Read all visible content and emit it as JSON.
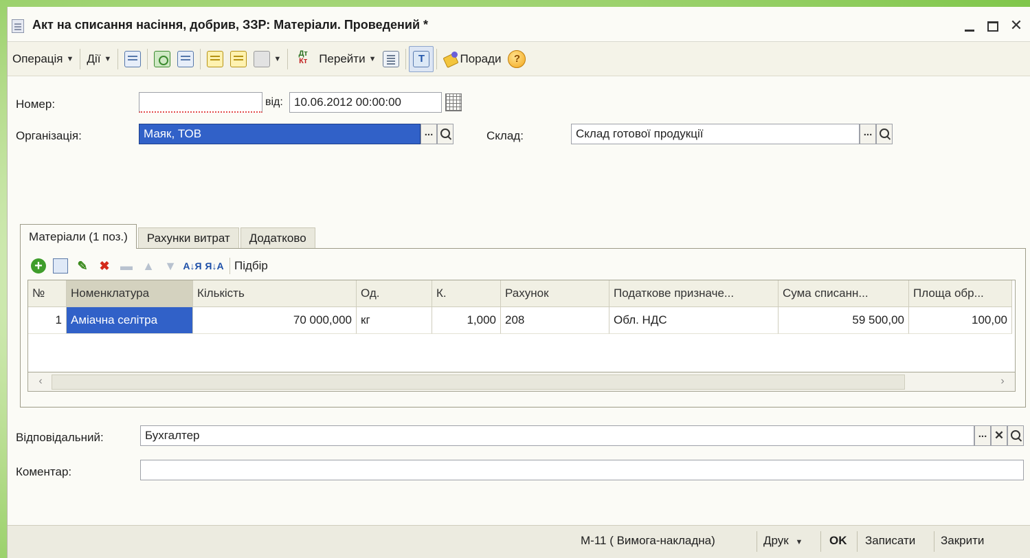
{
  "window": {
    "title": "Акт на списання насіння, добрив, ЗЗР: Матеріали. Проведений *",
    "buttons": {
      "minimize": "minimize",
      "maximize": "maximize",
      "close": "close"
    }
  },
  "toolbar": {
    "operation": "Операція",
    "actions": "Дії",
    "goto": "Перейти",
    "tips": "Поради",
    "help": "?",
    "dt": "Дт",
    "kt": "Кт"
  },
  "form": {
    "number_label": "Номер:",
    "number_value": "",
    "from_label": "від:",
    "date_value": "10.06.2012 00:00:00",
    "org_label": "Організація:",
    "org_value": "Маяк, ТОВ",
    "warehouse_label": "Склад:",
    "warehouse_value": "Склад готової продукції",
    "responsible_label": "Відповідальний:",
    "responsible_value": "Бухгалтер",
    "comment_label": "Коментар:",
    "comment_value": ""
  },
  "tabs": [
    {
      "label": "Матеріали (1 поз.)",
      "active": true
    },
    {
      "label": "Рахунки витрат",
      "active": false
    },
    {
      "label": "Додатково",
      "active": false
    }
  ],
  "table_toolbar": {
    "pick_label": "Підбір",
    "sort_asc": "А↓Я",
    "sort_desc": "Я↓А"
  },
  "table": {
    "columns": [
      "№",
      "Номенклатура",
      "Кількість",
      "Од.",
      "К.",
      "Рахунок",
      "Податкове призначе...",
      "Сума списанн...",
      "Площа обр..."
    ],
    "rows": [
      [
        "1",
        "Аміачна селітра",
        "70 000,000",
        "кг",
        "1,000",
        "208",
        "Обл. НДС",
        "59 500,00",
        "100,00"
      ]
    ]
  },
  "bottom": {
    "form_m11": "М-11 ( Вимога-накладна)",
    "print": "Друк",
    "ok": "OK",
    "save": "Записати",
    "close": "Закрити"
  }
}
